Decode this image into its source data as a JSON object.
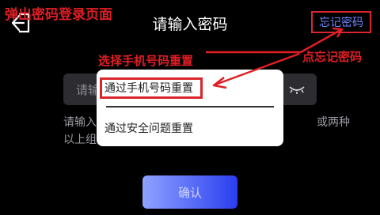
{
  "annotations": {
    "top_left": "弹出密码登录页面",
    "select_phone": "选择手机号码重置",
    "click_forgot": "点忘记密码"
  },
  "header": {
    "title": "请输入密码",
    "forgot_label": "忘记密码"
  },
  "password_field": {
    "placeholder_visible": "请输"
  },
  "hint": {
    "left_text": "请输入\n以上组",
    "right_text": "或两种"
  },
  "popup": {
    "items": [
      {
        "label": "通过手机号码重置"
      },
      {
        "label": "通过安全问题重置"
      }
    ]
  },
  "confirm_label": "确认",
  "colors": {
    "annotation_red": "#e01e25",
    "forgot_link": "#6f86ff",
    "button_gradient_start": "#8fa2ff",
    "button_gradient_end": "#2a3ef0"
  }
}
